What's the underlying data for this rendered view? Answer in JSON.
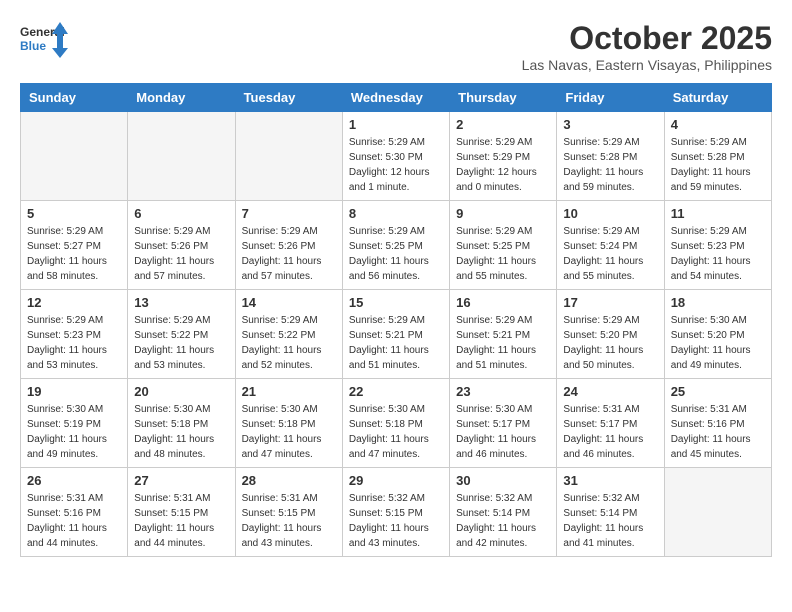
{
  "header": {
    "logo_line1": "General",
    "logo_line2": "Blue",
    "month": "October 2025",
    "location": "Las Navas, Eastern Visayas, Philippines"
  },
  "weekdays": [
    "Sunday",
    "Monday",
    "Tuesday",
    "Wednesday",
    "Thursday",
    "Friday",
    "Saturday"
  ],
  "weeks": [
    [
      {
        "day": "",
        "empty": true
      },
      {
        "day": "",
        "empty": true
      },
      {
        "day": "",
        "empty": true
      },
      {
        "day": "1",
        "sunrise": "5:29 AM",
        "sunset": "5:30 PM",
        "daylight": "12 hours and 1 minute."
      },
      {
        "day": "2",
        "sunrise": "5:29 AM",
        "sunset": "5:29 PM",
        "daylight": "12 hours and 0 minutes."
      },
      {
        "day": "3",
        "sunrise": "5:29 AM",
        "sunset": "5:28 PM",
        "daylight": "11 hours and 59 minutes."
      },
      {
        "day": "4",
        "sunrise": "5:29 AM",
        "sunset": "5:28 PM",
        "daylight": "11 hours and 59 minutes."
      }
    ],
    [
      {
        "day": "5",
        "sunrise": "5:29 AM",
        "sunset": "5:27 PM",
        "daylight": "11 hours and 58 minutes."
      },
      {
        "day": "6",
        "sunrise": "5:29 AM",
        "sunset": "5:26 PM",
        "daylight": "11 hours and 57 minutes."
      },
      {
        "day": "7",
        "sunrise": "5:29 AM",
        "sunset": "5:26 PM",
        "daylight": "11 hours and 57 minutes."
      },
      {
        "day": "8",
        "sunrise": "5:29 AM",
        "sunset": "5:25 PM",
        "daylight": "11 hours and 56 minutes."
      },
      {
        "day": "9",
        "sunrise": "5:29 AM",
        "sunset": "5:25 PM",
        "daylight": "11 hours and 55 minutes."
      },
      {
        "day": "10",
        "sunrise": "5:29 AM",
        "sunset": "5:24 PM",
        "daylight": "11 hours and 55 minutes."
      },
      {
        "day": "11",
        "sunrise": "5:29 AM",
        "sunset": "5:23 PM",
        "daylight": "11 hours and 54 minutes."
      }
    ],
    [
      {
        "day": "12",
        "sunrise": "5:29 AM",
        "sunset": "5:23 PM",
        "daylight": "11 hours and 53 minutes."
      },
      {
        "day": "13",
        "sunrise": "5:29 AM",
        "sunset": "5:22 PM",
        "daylight": "11 hours and 53 minutes."
      },
      {
        "day": "14",
        "sunrise": "5:29 AM",
        "sunset": "5:22 PM",
        "daylight": "11 hours and 52 minutes."
      },
      {
        "day": "15",
        "sunrise": "5:29 AM",
        "sunset": "5:21 PM",
        "daylight": "11 hours and 51 minutes."
      },
      {
        "day": "16",
        "sunrise": "5:29 AM",
        "sunset": "5:21 PM",
        "daylight": "11 hours and 51 minutes."
      },
      {
        "day": "17",
        "sunrise": "5:29 AM",
        "sunset": "5:20 PM",
        "daylight": "11 hours and 50 minutes."
      },
      {
        "day": "18",
        "sunrise": "5:30 AM",
        "sunset": "5:20 PM",
        "daylight": "11 hours and 49 minutes."
      }
    ],
    [
      {
        "day": "19",
        "sunrise": "5:30 AM",
        "sunset": "5:19 PM",
        "daylight": "11 hours and 49 minutes."
      },
      {
        "day": "20",
        "sunrise": "5:30 AM",
        "sunset": "5:18 PM",
        "daylight": "11 hours and 48 minutes."
      },
      {
        "day": "21",
        "sunrise": "5:30 AM",
        "sunset": "5:18 PM",
        "daylight": "11 hours and 47 minutes."
      },
      {
        "day": "22",
        "sunrise": "5:30 AM",
        "sunset": "5:18 PM",
        "daylight": "11 hours and 47 minutes."
      },
      {
        "day": "23",
        "sunrise": "5:30 AM",
        "sunset": "5:17 PM",
        "daylight": "11 hours and 46 minutes."
      },
      {
        "day": "24",
        "sunrise": "5:31 AM",
        "sunset": "5:17 PM",
        "daylight": "11 hours and 46 minutes."
      },
      {
        "day": "25",
        "sunrise": "5:31 AM",
        "sunset": "5:16 PM",
        "daylight": "11 hours and 45 minutes."
      }
    ],
    [
      {
        "day": "26",
        "sunrise": "5:31 AM",
        "sunset": "5:16 PM",
        "daylight": "11 hours and 44 minutes."
      },
      {
        "day": "27",
        "sunrise": "5:31 AM",
        "sunset": "5:15 PM",
        "daylight": "11 hours and 44 minutes."
      },
      {
        "day": "28",
        "sunrise": "5:31 AM",
        "sunset": "5:15 PM",
        "daylight": "11 hours and 43 minutes."
      },
      {
        "day": "29",
        "sunrise": "5:32 AM",
        "sunset": "5:15 PM",
        "daylight": "11 hours and 43 minutes."
      },
      {
        "day": "30",
        "sunrise": "5:32 AM",
        "sunset": "5:14 PM",
        "daylight": "11 hours and 42 minutes."
      },
      {
        "day": "31",
        "sunrise": "5:32 AM",
        "sunset": "5:14 PM",
        "daylight": "11 hours and 41 minutes."
      },
      {
        "day": "",
        "empty": true
      }
    ]
  ]
}
